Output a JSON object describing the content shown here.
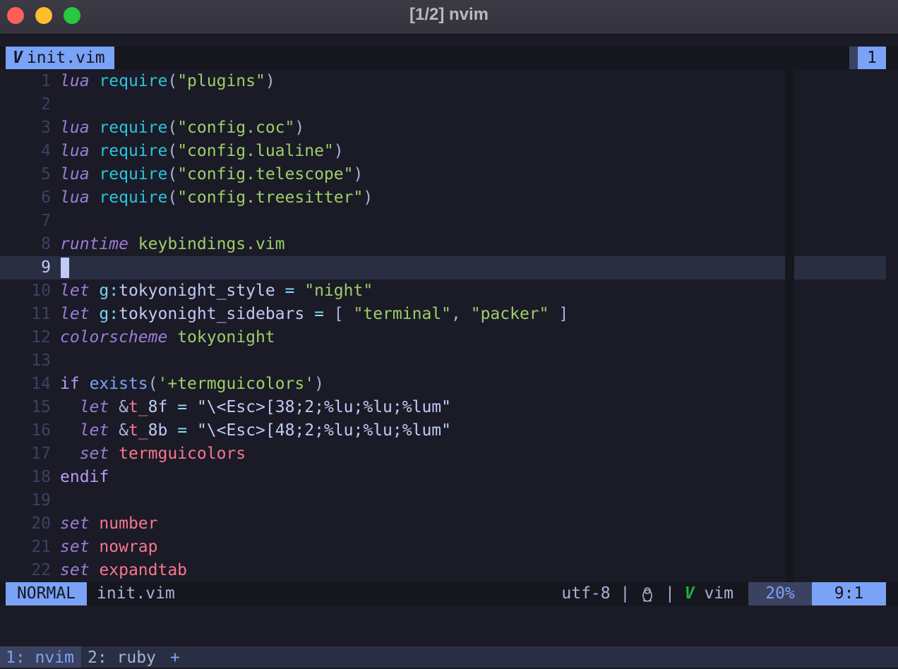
{
  "window": {
    "title": "[1/2] nvim",
    "buttons": [
      "close",
      "minimize",
      "zoom"
    ]
  },
  "tabline": {
    "icon": "V",
    "buffer_name": "init.vim",
    "buffer_number": "1"
  },
  "editor": {
    "current_line": 9,
    "lines": [
      {
        "n": "1",
        "tokens": [
          [
            "lua",
            "kw"
          ],
          [
            " "
          ],
          [
            "require",
            "fn"
          ],
          [
            "(",
            "p"
          ],
          [
            "\"plugins\"",
            "str"
          ],
          [
            ")",
            "p"
          ]
        ]
      },
      {
        "n": "2",
        "tokens": []
      },
      {
        "n": "3",
        "tokens": [
          [
            "lua",
            "kw"
          ],
          [
            " "
          ],
          [
            "require",
            "fn"
          ],
          [
            "(",
            "p"
          ],
          [
            "\"config.coc\"",
            "str"
          ],
          [
            ")",
            "p"
          ]
        ]
      },
      {
        "n": "4",
        "tokens": [
          [
            "lua",
            "kw"
          ],
          [
            " "
          ],
          [
            "require",
            "fn"
          ],
          [
            "(",
            "p"
          ],
          [
            "\"config.lualine\"",
            "str"
          ],
          [
            ")",
            "p"
          ]
        ]
      },
      {
        "n": "5",
        "tokens": [
          [
            "lua",
            "kw"
          ],
          [
            " "
          ],
          [
            "require",
            "fn"
          ],
          [
            "(",
            "p"
          ],
          [
            "\"config.telescope\"",
            "str"
          ],
          [
            ")",
            "p"
          ]
        ]
      },
      {
        "n": "6",
        "tokens": [
          [
            "lua",
            "kw"
          ],
          [
            " "
          ],
          [
            "require",
            "fn"
          ],
          [
            "(",
            "p"
          ],
          [
            "\"config.treesitter\"",
            "str"
          ],
          [
            ")",
            "p"
          ]
        ]
      },
      {
        "n": "7",
        "tokens": []
      },
      {
        "n": "8",
        "tokens": [
          [
            "runtime",
            "kw"
          ],
          [
            " "
          ],
          [
            "keybindings.vim",
            "str"
          ]
        ]
      },
      {
        "n": "9",
        "tokens": []
      },
      {
        "n": "10",
        "tokens": [
          [
            "let",
            "kw"
          ],
          [
            " "
          ],
          [
            "g:",
            "ns"
          ],
          [
            "tokyonight_style"
          ],
          [
            " "
          ],
          [
            "=",
            "op"
          ],
          [
            " "
          ],
          [
            "\"night\"",
            "str"
          ]
        ]
      },
      {
        "n": "11",
        "tokens": [
          [
            "let",
            "kw"
          ],
          [
            " "
          ],
          [
            "g:",
            "ns"
          ],
          [
            "tokyonight_sidebars"
          ],
          [
            " "
          ],
          [
            "=",
            "op"
          ],
          [
            " "
          ],
          [
            "[",
            "p"
          ],
          [
            " "
          ],
          [
            "\"terminal\"",
            "str"
          ],
          [
            ",",
            "p"
          ],
          [
            " "
          ],
          [
            "\"packer\"",
            "str"
          ],
          [
            " "
          ],
          [
            "]",
            "p"
          ]
        ]
      },
      {
        "n": "12",
        "tokens": [
          [
            "colorscheme",
            "kw"
          ],
          [
            " "
          ],
          [
            "tokyonight",
            "str"
          ]
        ]
      },
      {
        "n": "13",
        "tokens": []
      },
      {
        "n": "14",
        "tokens": [
          [
            "if",
            "cond"
          ],
          [
            " "
          ],
          [
            "exists",
            "fn2"
          ],
          [
            "(",
            "p"
          ],
          [
            "'+termguicolors'",
            "str"
          ],
          [
            ")",
            "p"
          ]
        ]
      },
      {
        "n": "15",
        "tokens": [
          [
            "  "
          ],
          [
            "let",
            "kw"
          ],
          [
            " "
          ],
          [
            "&",
            "amp"
          ],
          [
            "t_",
            "opt"
          ],
          [
            "8f"
          ],
          [
            " "
          ],
          [
            "=",
            "op"
          ],
          [
            " "
          ],
          [
            "\"\\<Esc>[38;2;%lu;%lu;%lum\"",
            "plain"
          ]
        ]
      },
      {
        "n": "16",
        "tokens": [
          [
            "  "
          ],
          [
            "let",
            "kw"
          ],
          [
            " "
          ],
          [
            "&",
            "amp"
          ],
          [
            "t_",
            "opt"
          ],
          [
            "8b"
          ],
          [
            " "
          ],
          [
            "=",
            "op"
          ],
          [
            " "
          ],
          [
            "\"\\<Esc>[48;2;%lu;%lu;%lum\"",
            "plain"
          ]
        ]
      },
      {
        "n": "17",
        "tokens": [
          [
            "  "
          ],
          [
            "set",
            "kw"
          ],
          [
            " "
          ],
          [
            "termguicolors",
            "opt"
          ]
        ]
      },
      {
        "n": "18",
        "tokens": [
          [
            "endif",
            "cond"
          ]
        ]
      },
      {
        "n": "19",
        "tokens": []
      },
      {
        "n": "20",
        "tokens": [
          [
            "set",
            "kw"
          ],
          [
            " "
          ],
          [
            "number",
            "opt"
          ]
        ]
      },
      {
        "n": "21",
        "tokens": [
          [
            "set",
            "kw"
          ],
          [
            " "
          ],
          [
            "nowrap",
            "opt"
          ]
        ]
      },
      {
        "n": "22",
        "tokens": [
          [
            "set",
            "kw"
          ],
          [
            " "
          ],
          [
            "expandtab",
            "opt"
          ]
        ]
      }
    ]
  },
  "syntax_colors": {
    "kw": "#9d7cd8",
    "fn": "#2ac3de",
    "fn2": "#7aa2f7",
    "str": "#9ece6a",
    "p": "#a9b1d6",
    "op": "#89ddff",
    "ns": "#7dcfff",
    "cond": "#bb9af7",
    "amp": "#a9b1d6",
    "opt": "#f7768e",
    "plain": "#c0caf5"
  },
  "italic_classes": [
    "kw"
  ],
  "statusline": {
    "mode": "NORMAL",
    "filename": "init.vim",
    "encoding": "utf-8",
    "sep1": " | ",
    "os_icon": "tux-icon",
    "sep2": " | ",
    "filetype_icon": "V",
    "filetype": "vim",
    "progress": "20%",
    "location": "9:1"
  },
  "tmux": {
    "window1": "1: nvim",
    "window2": "2: ruby",
    "new_window": "+"
  }
}
